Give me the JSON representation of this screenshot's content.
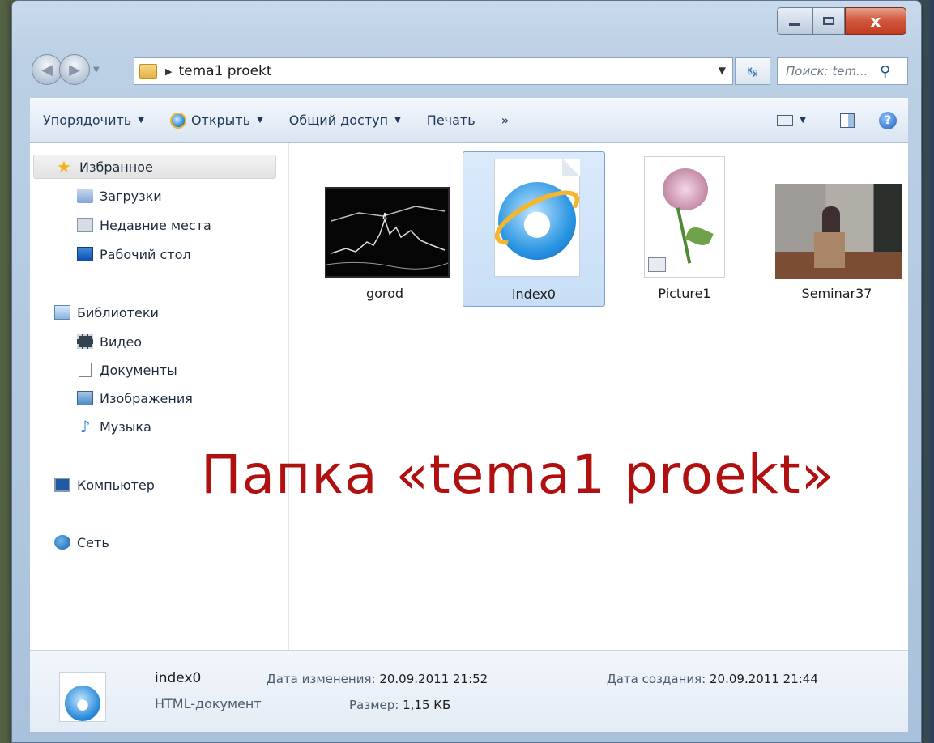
{
  "window": {
    "caption_close": "x"
  },
  "address": {
    "path": "tema1 proekt",
    "search_placeholder": "Поиск: tem..."
  },
  "toolbar": {
    "organize": "Упорядочить",
    "open": "Открыть",
    "share": "Общий доступ",
    "print": "Печать",
    "more": "»",
    "help": "?"
  },
  "nav_pane": {
    "favorites": "Избранное",
    "downloads": "Загрузки",
    "recent": "Недавние места",
    "desktop": "Рабочий стол",
    "libraries": "Библиотеки",
    "video": "Видео",
    "documents": "Документы",
    "images": "Изображения",
    "music": "Музыка",
    "computer": "Компьютер",
    "network": "Сеть"
  },
  "files": [
    {
      "name": "gorod"
    },
    {
      "name": "index0"
    },
    {
      "name": "Picture1"
    },
    {
      "name": "Seminar37"
    }
  ],
  "caption": "Папка «tema1 proekt»",
  "details": {
    "name": "index0",
    "type": "HTML-документ",
    "modified_label": "Дата изменения:",
    "modified_value": "20.09.2011 21:52",
    "size_label": "Размер:",
    "size_value": "1,15 КБ",
    "created_label": "Дата создания:",
    "created_value": "20.09.2011 21:44"
  }
}
